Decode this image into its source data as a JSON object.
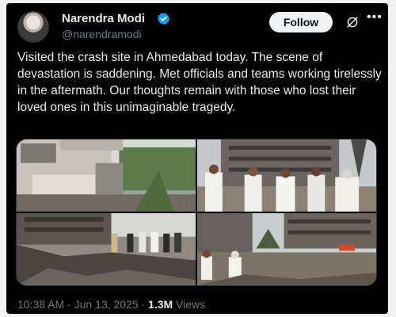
{
  "author": {
    "name": "Narendra Modi",
    "handle": "@narendramodi",
    "verified_color": "#1d9bf0"
  },
  "header": {
    "follow_label": "Follow",
    "grok_icon": "grok-icon",
    "more_icon": "more-icon"
  },
  "tweet": {
    "text": "Visited the crash site in Ahmedabad today. The scene of devastation is saddening. Met officials and teams working tirelessly in the aftermath. Our thoughts remain with those who lost their loved ones in this unimaginable tragedy."
  },
  "media": {
    "photos": [
      "crash-site-building-photo",
      "officials-meeting-photo",
      "debris-walkthrough-photo",
      "site-inspection-photo"
    ]
  },
  "meta": {
    "time": "10:38 AM",
    "separator": "·",
    "date": "Jun 13, 2025",
    "views_count": "1.3M",
    "views_label": "Views"
  },
  "colors": {
    "background": "#000000",
    "text": "#e7e9ea",
    "secondary_text": "#71767b",
    "follow_bg": "#eff3f4"
  }
}
